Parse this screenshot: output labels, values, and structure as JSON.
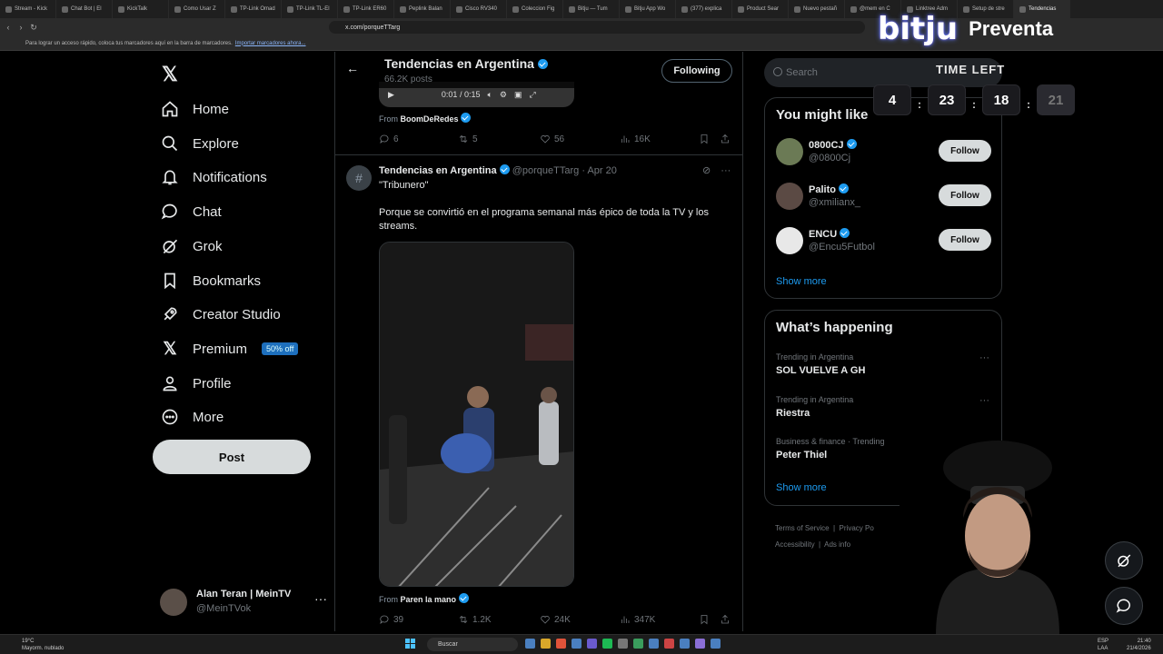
{
  "browser": {
    "tabs": [
      "Stream - Kick",
      "Chat Bot | El",
      "KickTalk",
      "Como Usar Z",
      "TP-Link Omad",
      "TP-Link TL-El",
      "TP-Link ER60",
      "Peplink Balan",
      "Cisco RV340",
      "Coleccion Fig",
      "Bitju — Tum",
      "Bitju App Wo",
      "(377) explica",
      "Product Sear",
      "Nuevo pestañ",
      "@mem en C",
      "Linktree Adm",
      "Setup de stre",
      "Tendencias"
    ],
    "url": "x.com/porqueTTarg",
    "bookmarks_hint": "Para lograr un acceso rápido, coloca tus marcadores aquí en la barra de marcadores.",
    "bookmarks_import": "Importar marcadores ahora..."
  },
  "nav": {
    "items": [
      {
        "label": "Home",
        "icon": "home-icon"
      },
      {
        "label": "Explore",
        "icon": "search-icon"
      },
      {
        "label": "Notifications",
        "icon": "bell-icon"
      },
      {
        "label": "Chat",
        "icon": "chat-icon"
      },
      {
        "label": "Grok",
        "icon": "grok-icon"
      },
      {
        "label": "Bookmarks",
        "icon": "bookmark-icon"
      },
      {
        "label": "Creator Studio",
        "icon": "rocket-icon"
      },
      {
        "label": "Premium",
        "icon": "x-logo-icon"
      },
      {
        "label": "Profile",
        "icon": "person-icon"
      },
      {
        "label": "More",
        "icon": "more-circle-icon"
      }
    ],
    "premium_badge": "50% off",
    "post_button": "Post",
    "account": {
      "name": "Alan Teran | MeinTV",
      "handle": "@MeinTVok"
    }
  },
  "header": {
    "title": "Tendencias en Argentina",
    "posts_count": "66.2K posts",
    "following_button": "Following"
  },
  "video": {
    "time": "0:01 / 0:15"
  },
  "tweet1": {
    "from_label": "From",
    "from": "BoomDeRedes",
    "replies": "6",
    "reposts": "5",
    "likes": "56",
    "views": "16K"
  },
  "tweet2": {
    "author": "Tendencias en Argentina",
    "handle": "@porqueTTarg",
    "date": "Apr 20",
    "line1": "\"Tribunero\"",
    "line2": "Porque se convirtió en el programa semanal más épico de toda la TV y los streams.",
    "from_label": "From",
    "from": "Paren la mano",
    "replies": "39",
    "reposts": "1.2K",
    "likes": "24K",
    "views": "347K"
  },
  "sidebar": {
    "search_placeholder": "Search",
    "you_might_like": "You might like",
    "suggestions": [
      {
        "name": "0800CJ",
        "handle": "@0800Cj",
        "button": "Follow"
      },
      {
        "name": "Palito",
        "handle": "@xmilianx_",
        "button": "Follow"
      },
      {
        "name": "ENCU",
        "handle": "@Encu5Futbol",
        "button": "Follow"
      }
    ],
    "show_more": "Show more",
    "whats_happening": "What’s happening",
    "trends": [
      {
        "context": "Trending in Argentina",
        "title": "SOL VUELVE A GH"
      },
      {
        "context": "Trending in Argentina",
        "title": "Riestra"
      },
      {
        "context": "Business & finance · Trending",
        "title": "Peter Thiel"
      }
    ],
    "footer": [
      "Terms of Service",
      "Privacy Po",
      "Accessibility",
      "Ads info"
    ]
  },
  "overlay": {
    "brand": "bitju",
    "preventa": "Preventa",
    "time_left": "TIME LEFT",
    "countdown": [
      "4",
      "23",
      "18",
      "21"
    ]
  },
  "taskbar": {
    "weather_temp": "19°C",
    "weather_desc": "Mayorm. nublado",
    "search": "Buscar",
    "lang1": "ESP",
    "lang2": "LAA",
    "time": "21:40",
    "date": "21/4/2026"
  }
}
